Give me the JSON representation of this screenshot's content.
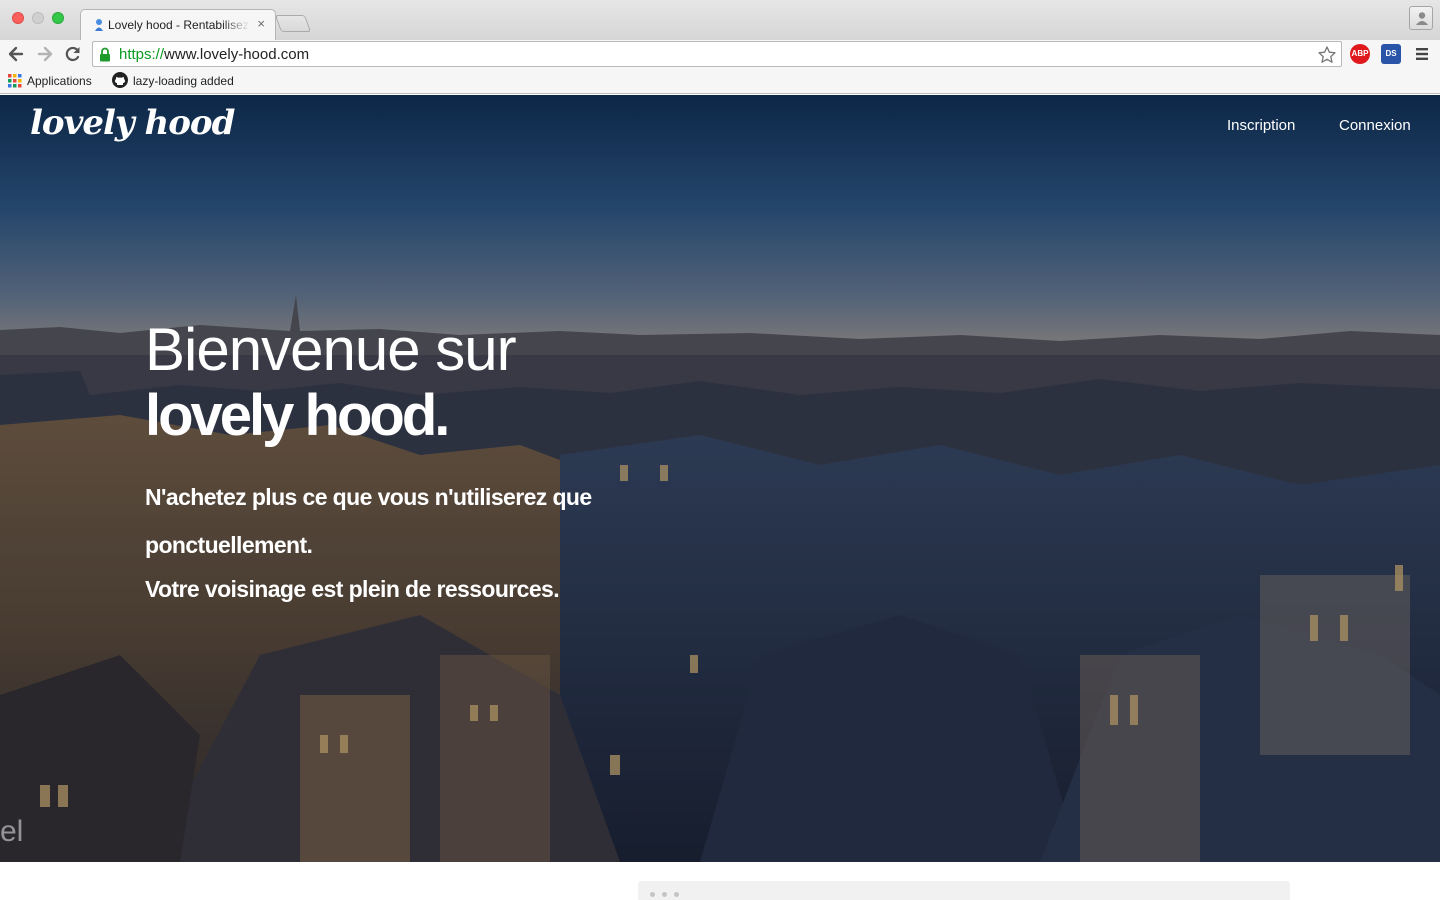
{
  "browser": {
    "tab": {
      "title": "Lovely hood - Rentabilisez",
      "close": "×"
    },
    "url": {
      "scheme": "https://",
      "rest": "www.lovely-hood.com"
    },
    "bookmarks": [
      {
        "label": "Applications",
        "icon": "apps-grid-icon"
      },
      {
        "label": "lazy-loading added",
        "icon": "github-icon"
      }
    ],
    "extensions": {
      "abp": "ABP",
      "second": "DS"
    }
  },
  "site": {
    "logo": "lovely hood",
    "nav": {
      "inscription": "Inscription",
      "connexion": "Connexion"
    },
    "hero": {
      "headline_line1": "Bienvenue sur",
      "headline_line2": "lovely hood.",
      "tagline": "N'achetez plus ce que vous n'utiliserez que ponctuellement.",
      "tagline2": "Votre voisinage est plein de ressources.",
      "corner_text": "el"
    }
  },
  "colors": {
    "url_scheme": "#0a9b22",
    "abp_red": "#e0191c",
    "hero_text": "#ffffff"
  }
}
